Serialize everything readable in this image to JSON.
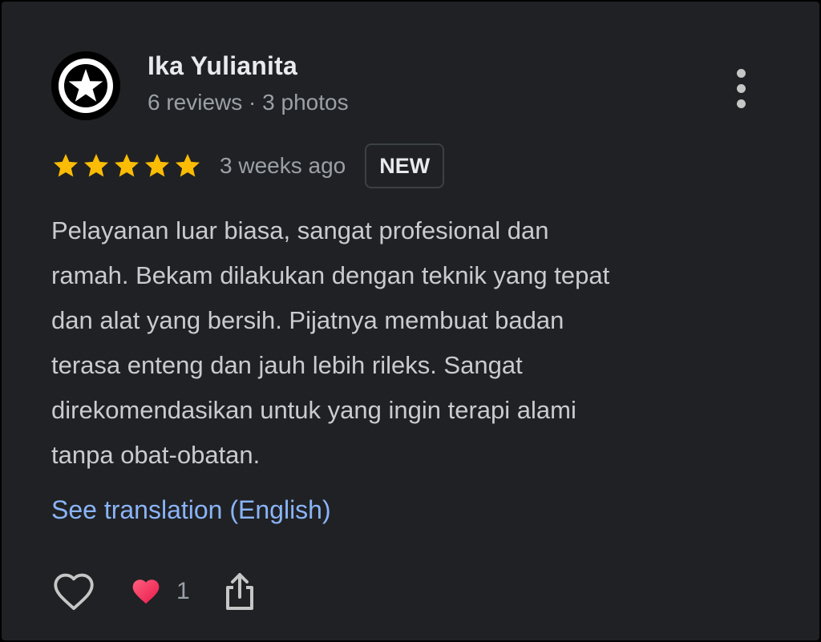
{
  "reviewer": {
    "name": "Ika Yulianita",
    "meta": "6 reviews · 3 photos",
    "avatar_icon": "star-badge-icon"
  },
  "review": {
    "rating": 5,
    "rating_max": 5,
    "date": "3 weeks ago",
    "badge": "NEW",
    "text_lines": [
      "Pelayanan luar biasa, sangat profesional dan",
      "ramah. Bekam dilakukan dengan teknik yang tepat",
      "dan alat yang bersih. Pijatnya membuat badan",
      "terasa enteng dan jauh lebih rileks. Sangat",
      "direkomendasikan untuk yang ingin terapi alami",
      "tanpa obat-obatan."
    ],
    "translation_link": "See translation (English)"
  },
  "actions": {
    "like_icon": "heart-outline-icon",
    "reaction_icon": "heart-filled-icon",
    "reaction_count": "1",
    "share_icon": "share-icon",
    "more_icon": "more-vertical-icon"
  },
  "colors": {
    "background": "#202124",
    "star": "#fbbc04",
    "link": "#8ab4f8",
    "reaction_heart": "#f0355e"
  }
}
